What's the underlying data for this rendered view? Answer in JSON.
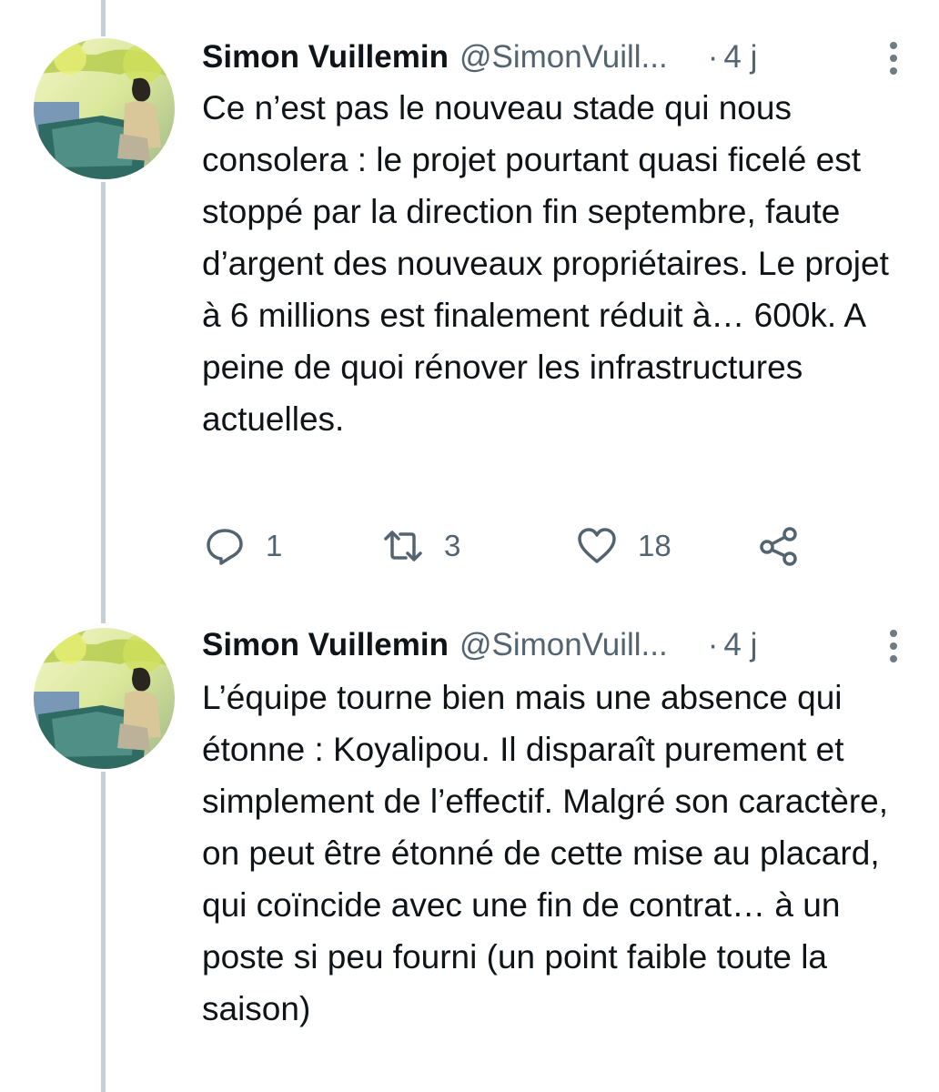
{
  "tweets": [
    {
      "author_name": "Simon Vuillemin",
      "author_handle": "@SimonVuill...",
      "separator": "·",
      "time": "4 j",
      "text": "Ce n’est pas le nouveau stade qui nous consolera : le projet pourtant quasi ficelé est stoppé par la direction fin septembre, faute d’argent des nouveaux propriétaires. Le projet à 6 millions est finalement réduit à… 600k. A peine de quoi rénover les infrastructures actuelles.",
      "replies": "1",
      "retweets": "3",
      "likes": "18"
    },
    {
      "author_name": "Simon Vuillemin",
      "author_handle": "@SimonVuill...",
      "separator": "·",
      "time": "4 j",
      "text": "L’équipe tourne bien mais une absence qui étonne : Koyalipou. Il disparaît purement et simplement de l’effectif. Malgré son caractère, on peut être étonné de cette mise au placard, qui coïncide avec une fin de contrat… à un poste si peu fourni (un point faible toute la saison)"
    }
  ],
  "icons": {
    "avatar": "avatar-photo-person-on-boat",
    "more": "more-vertical-icon",
    "reply": "reply-icon",
    "retweet": "retweet-icon",
    "like": "heart-icon",
    "share": "share-icon"
  },
  "colors": {
    "text_primary": "#0f1419",
    "text_secondary": "#536471",
    "thread_line": "#c4cfd6"
  }
}
